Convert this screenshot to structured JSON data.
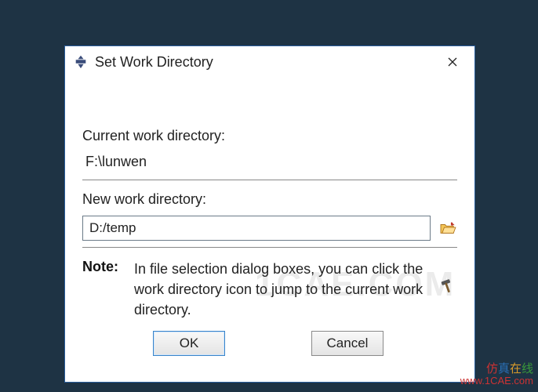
{
  "dialog": {
    "title": "Set Work Directory",
    "current_label": "Current work directory:",
    "current_path": "F:\\lunwen",
    "new_label": "New work directory:",
    "new_path": "D:/temp",
    "note_label": "Note:",
    "note_text": "In file selection dialog boxes, you can click the work directory icon to jump to the current work directory.",
    "ok_label": "OK",
    "cancel_label": "Cancel"
  },
  "watermark": {
    "text": "1CAE.COM",
    "footer_cn": "仿真在线",
    "footer_url": "www.1CAE.com"
  }
}
